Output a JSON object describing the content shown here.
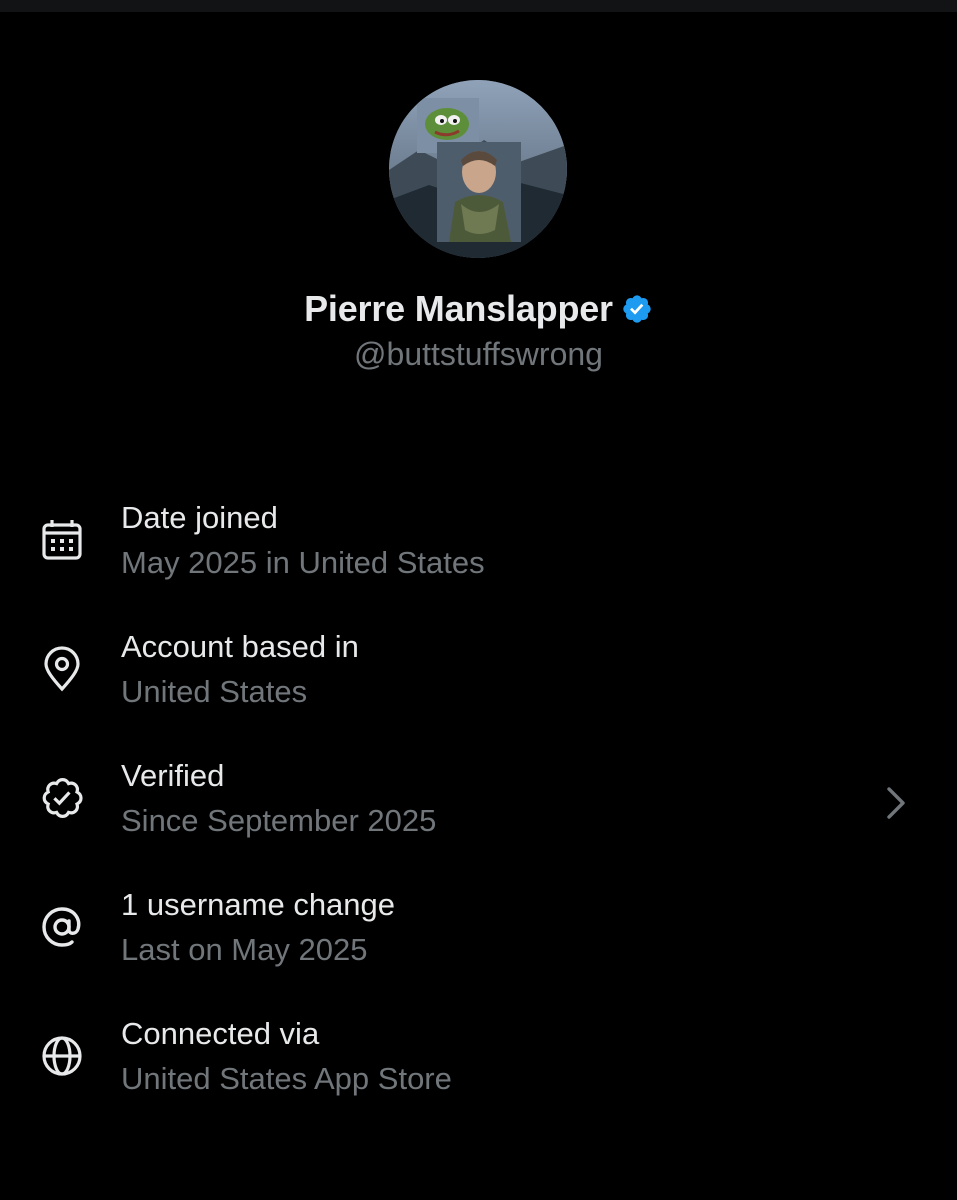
{
  "profile": {
    "display_name": "Pierre Manslapper",
    "handle": "@buttstuffswrong",
    "verified_badge_color": "#1d9bf0"
  },
  "info_rows": [
    {
      "icon": "calendar-icon",
      "title": "Date joined",
      "subtitle": "May 2025 in United States"
    },
    {
      "icon": "location-pin-icon",
      "title": "Account based in",
      "subtitle": "United States"
    },
    {
      "icon": "verified-seal-icon",
      "title": "Verified",
      "subtitle": "Since September 2025"
    },
    {
      "icon": "at-sign-icon",
      "title": "1 username change",
      "subtitle": "Last on May 2025"
    },
    {
      "icon": "globe-icon",
      "title": "Connected via",
      "subtitle": "United States App Store"
    }
  ],
  "colors": {
    "background": "#000000",
    "primary_text": "#e7e9ea",
    "secondary_text": "#71767b",
    "accent": "#1d9bf0"
  }
}
